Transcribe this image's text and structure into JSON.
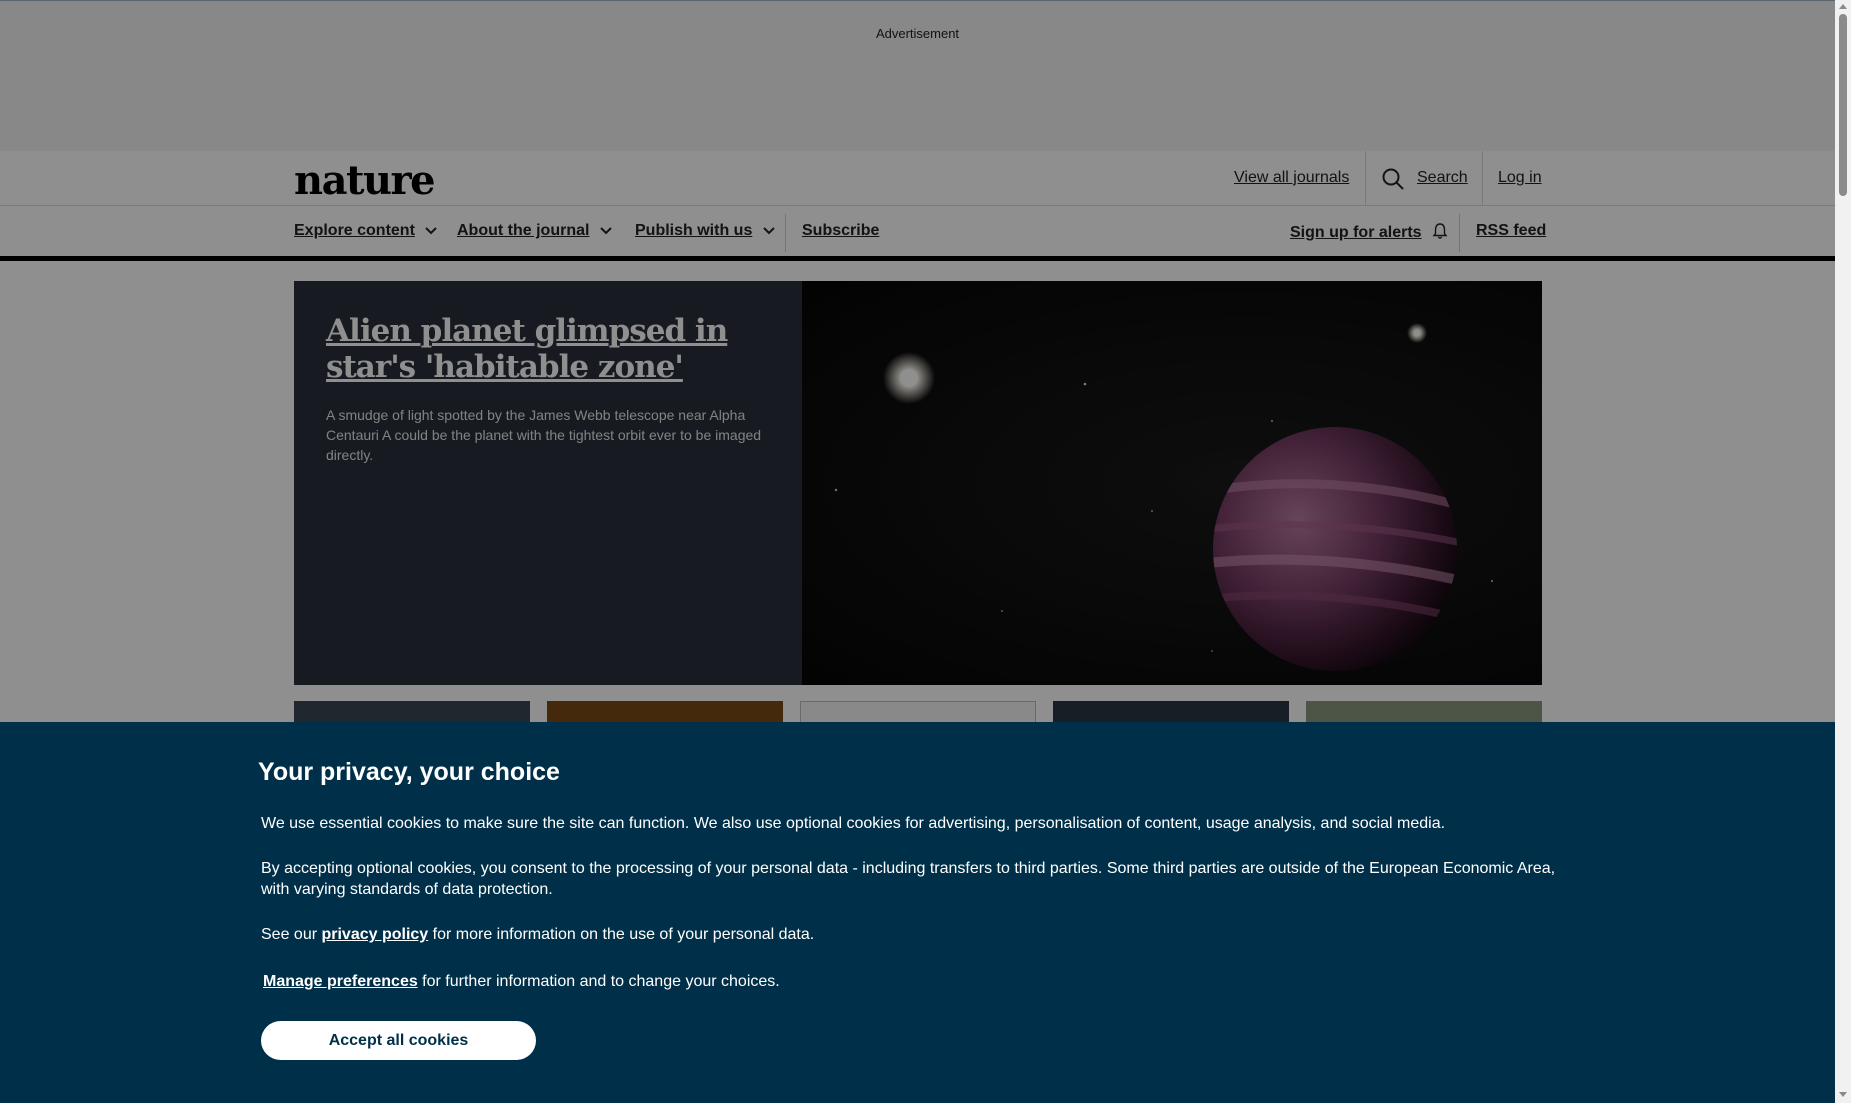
{
  "ad": {
    "label": "Advertisement"
  },
  "header": {
    "logo": "nature",
    "view_all_journals": "View all journals",
    "search": "Search",
    "login": "Log in"
  },
  "nav": {
    "explore": "Explore content",
    "about": "About the journal",
    "publish": "Publish with us",
    "subscribe": "Subscribe",
    "alerts": "Sign up for alerts",
    "rss": "RSS feed"
  },
  "hero": {
    "title": "Alien planet glimpsed in star's 'habitable zone'",
    "summary": "A smudge of light spotted by the James Webb telescope near Alpha Centauri A could be the planet with the tightest orbit ever to be imaged directly."
  },
  "cookie": {
    "title": "Your privacy, your choice",
    "p1": "We use essential cookies to make sure the site can function. We also use optional cookies for advertising, personalisation of content, usage analysis, and social media.",
    "p2": "By accepting optional cookies, you consent to the processing of your personal data - including transfers to third parties. Some third parties are outside of the European Economic Area, with varying standards of data protection.",
    "p3_before": "See our ",
    "p3_link": "privacy policy",
    "p3_after": " for more information on the use of your personal data.",
    "p4_link": "Manage preferences",
    "p4_after": " for further information and to change your choices.",
    "accept": "Accept all cookies"
  },
  "colors": {
    "cookie_bg": "#003049",
    "hero_text_bg": "#29303b"
  }
}
